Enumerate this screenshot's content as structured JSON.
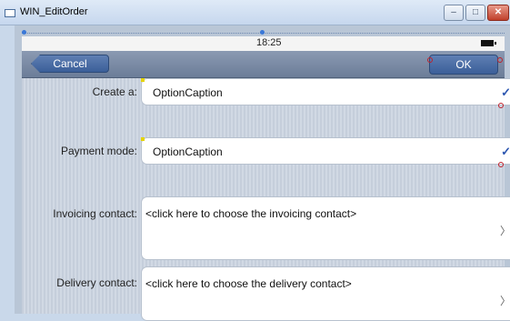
{
  "window": {
    "title": "WIN_EditOrder",
    "buttons": [
      "–",
      "□",
      "✕"
    ]
  },
  "status_bar": {
    "time": "18:25"
  },
  "navbar": {
    "cancel_label": "Cancel",
    "ok_label": "OK"
  },
  "form": {
    "create_a": {
      "label": "Create a:",
      "value": "OptionCaption"
    },
    "payment_mode": {
      "label": "Payment mode:",
      "value": "OptionCaption"
    },
    "invoicing_contact": {
      "label": "Invoicing contact:",
      "value": "<click here to choose the invoicing contact>"
    },
    "delivery_contact": {
      "label": "Delivery contact:",
      "value": "<click here to choose the delivery contact>"
    }
  },
  "icons": {
    "check": "✓",
    "chevron": "〉"
  },
  "colors": {
    "navbar": "#7a8ba5",
    "button": "#4a6aa3"
  }
}
